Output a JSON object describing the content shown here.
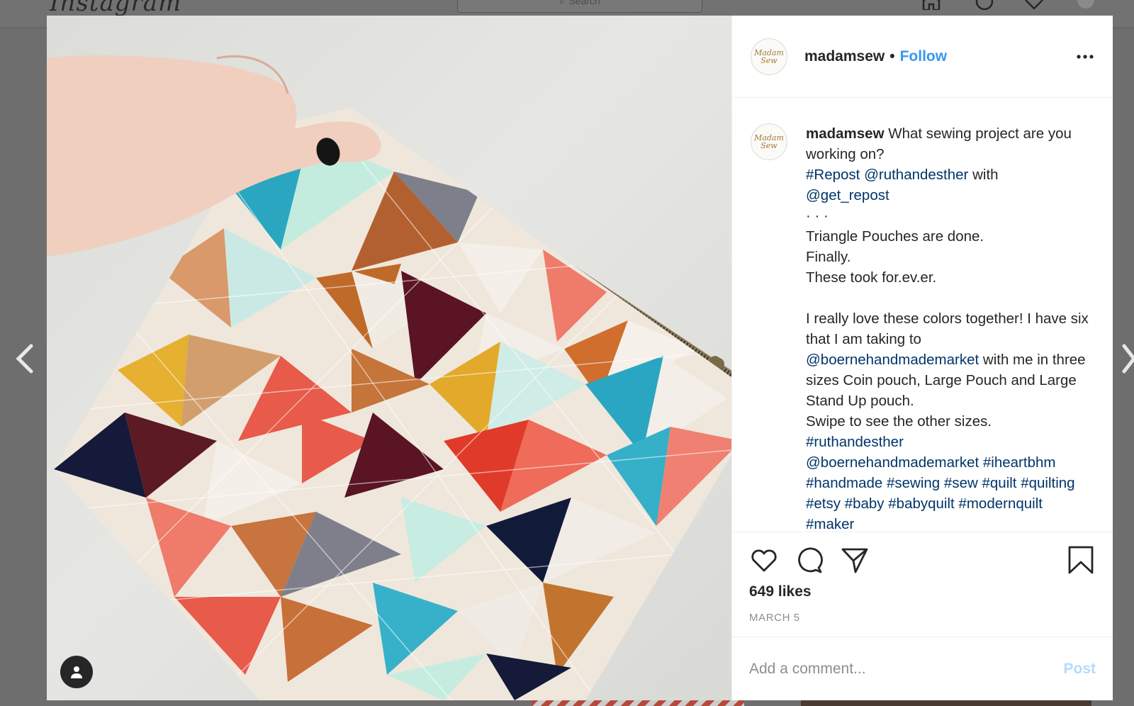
{
  "background_nav": {
    "logo": "Instagram",
    "search_placeholder": "Search"
  },
  "post": {
    "author": {
      "username": "madamsew",
      "avatar_text": "Madam Sew"
    },
    "follow_label": "Follow",
    "separator": "•",
    "caption": {
      "username": "madamsew",
      "lines": [
        {
          "parts": [
            {
              "text": " What sewing project are you working on?",
              "link": false
            }
          ]
        },
        {
          "parts": [
            {
              "text": "#Repost",
              "link": true
            },
            {
              "text": " ",
              "link": false
            },
            {
              "text": "@ruthandesther",
              "link": true
            },
            {
              "text": " with",
              "link": false
            }
          ]
        },
        {
          "parts": [
            {
              "text": "@get_repost",
              "link": true
            }
          ]
        },
        {
          "parts": [
            {
              "text": "  ·   ·   ·",
              "link": false
            }
          ]
        },
        {
          "parts": [
            {
              "text": "Triangle Pouches are done.",
              "link": false
            }
          ]
        },
        {
          "parts": [
            {
              "text": "Finally.",
              "link": false
            }
          ]
        },
        {
          "parts": [
            {
              "text": "These took for.ev.er.",
              "link": false
            }
          ]
        },
        {
          "parts": [
            {
              "text": "",
              "link": false
            }
          ]
        },
        {
          "parts": [
            {
              "text": "I really love these colors together! I have six that I am taking to ",
              "link": false
            },
            {
              "text": "@boernehandmademarket",
              "link": true
            },
            {
              "text": " with me in three sizes Coin pouch, Large Pouch and Large Stand Up pouch.",
              "link": false
            }
          ]
        },
        {
          "parts": [
            {
              "text": "Swipe to see the other sizes.",
              "link": false
            }
          ]
        },
        {
          "parts": [
            {
              "text": "#ruthandesther",
              "link": true
            }
          ]
        },
        {
          "parts": [
            {
              "text": "@boernehandmademarket",
              "link": true
            },
            {
              "text": " ",
              "link": false
            },
            {
              "text": "#iheartbhm",
              "link": true
            },
            {
              "text": " ",
              "link": false
            },
            {
              "text": "#handmade",
              "link": true
            },
            {
              "text": " ",
              "link": false
            },
            {
              "text": "#sewing",
              "link": true
            },
            {
              "text": " ",
              "link": false
            },
            {
              "text": "#sew",
              "link": true
            },
            {
              "text": " ",
              "link": false
            },
            {
              "text": "#quilt",
              "link": true
            },
            {
              "text": " ",
              "link": false
            },
            {
              "text": "#quilting",
              "link": true
            },
            {
              "text": " ",
              "link": false
            },
            {
              "text": "#etsy",
              "link": true
            },
            {
              "text": " ",
              "link": false
            },
            {
              "text": "#baby",
              "link": true
            },
            {
              "text": " ",
              "link": false
            },
            {
              "text": "#babyquilt",
              "link": true
            },
            {
              "text": " ",
              "link": false
            },
            {
              "text": "#modernquilt",
              "link": true
            },
            {
              "text": " ",
              "link": false
            },
            {
              "text": "#maker",
              "link": true
            }
          ]
        }
      ]
    },
    "likes_text": "649 likes",
    "date_text": "MARCH 5",
    "comment": {
      "placeholder": "Add a comment...",
      "post_label": "Post"
    }
  },
  "colors": {
    "link": "#003569",
    "follow": "#3897f0",
    "post_disabled": "#b3dbff",
    "overlay": "#6e6e6e"
  },
  "icons": [
    "home-icon",
    "explore-icon",
    "heart-icon",
    "profile-icon",
    "chevron-left-icon",
    "chevron-right-icon",
    "more-icon",
    "like-icon",
    "comment-icon",
    "share-icon",
    "save-icon",
    "user-tag-icon"
  ]
}
